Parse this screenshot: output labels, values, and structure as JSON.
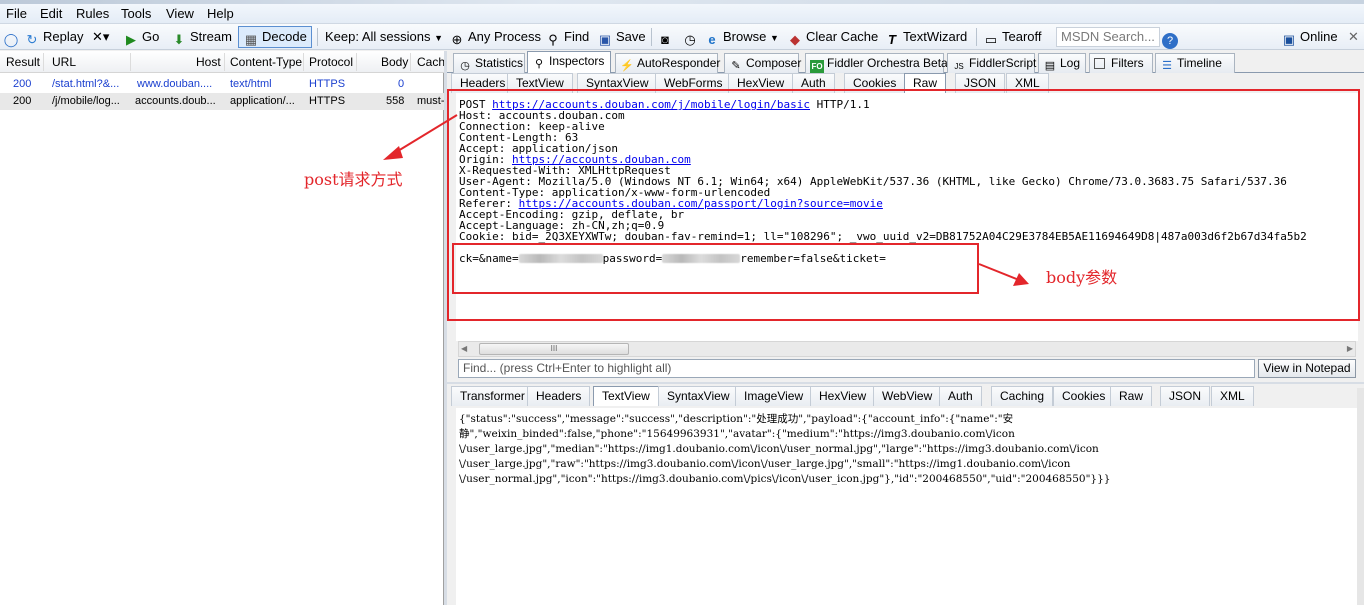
{
  "menu": [
    "File",
    "Edit",
    "Rules",
    "Tools",
    "View",
    "Help"
  ],
  "toolbar": {
    "replay": "Replay",
    "remove": "✕▾",
    "go": "Go",
    "stream": "Stream",
    "decode": "Decode",
    "keep": "Keep: All sessions",
    "any_process": "Any Process",
    "find": "Find",
    "save": "Save",
    "browse": "Browse",
    "clear_cache": "Clear Cache",
    "textwizard": "TextWizard",
    "tearoff": "Tearoff",
    "msdn_search": "MSDN Search...",
    "online": "Online"
  },
  "sessions": {
    "columns": [
      "Result",
      "URL",
      "Host",
      "Content-Type",
      "Protocol",
      "Body",
      "Cachi"
    ],
    "rows": [
      {
        "result": "200",
        "url": "/stat.html?&...",
        "host": "www.douban....",
        "ctype": "text/html",
        "protocol": "HTTPS",
        "body": "0",
        "caching": ""
      },
      {
        "result": "200",
        "url": "/j/mobile/log...",
        "host": "accounts.doub...",
        "ctype": "application/...",
        "protocol": "HTTPS",
        "body": "558",
        "caching": "must-"
      }
    ]
  },
  "main_tabs": [
    "Statistics",
    "Inspectors",
    "AutoResponder",
    "Composer",
    "Fiddler Orchestra Beta",
    "FiddlerScript",
    "Log",
    "Filters",
    "Timeline"
  ],
  "request_tabs": [
    "Headers",
    "TextView",
    "SyntaxView",
    "WebForms",
    "HexView",
    "Auth",
    "Cookies",
    "Raw",
    "JSON",
    "XML"
  ],
  "request": {
    "line1_method": "POST ",
    "line1_url": "https://accounts.douban.com/j/mobile/login/basic",
    "line1_proto": " HTTP/1.1",
    "host": "Host: accounts.douban.com",
    "connection": "Connection: keep-alive",
    "content_length": "Content-Length: 63",
    "accept": "Accept: application/json",
    "origin_label": "Origin: ",
    "origin_url": "https://accounts.douban.com",
    "xrw": "X-Requested-With: XMLHttpRequest",
    "ua": "User-Agent: Mozilla/5.0 (Windows NT 6.1; Win64; x64) AppleWebKit/537.36 (KHTML, like Gecko) Chrome/73.0.3683.75 Safari/537.36",
    "ctype": "Content-Type: application/x-www-form-urlencoded",
    "referer_label": "Referer: ",
    "referer_url": "https://accounts.douban.com/passport/login?source=movie",
    "accept_encoding": "Accept-Encoding: gzip, deflate, br",
    "accept_language": "Accept-Language: zh-CN,zh;q=0.9",
    "cookie": "Cookie: bid=_2Q3XEYXWTw; douban-fav-remind=1; ll=\"108296\"; _vwo_uuid_v2=DB81752A04C29E3784EB5AE11694649D8|487a003d6f2b67d34fa5b2",
    "body_a": "ck=&name=",
    "body_b": "password=",
    "body_c": "remember=false&ticket="
  },
  "annotations": {
    "post": "post请求方式",
    "body": "body参数"
  },
  "find_placeholder": "Find... (press Ctrl+Enter to highlight all)",
  "view_in_notepad": "View in Notepad",
  "scroll_label": "III",
  "response_tabs": [
    "Transformer",
    "Headers",
    "TextView",
    "SyntaxView",
    "ImageView",
    "HexView",
    "WebView",
    "Auth",
    "Caching",
    "Cookies",
    "Raw",
    "JSON",
    "XML"
  ],
  "response_lines": [
    "{\"status\":\"success\",\"message\":\"success\",\"description\":\"处理成功\",\"payload\":{\"account_info\":{\"name\":\"安",
    "静\",\"weixin_binded\":false,\"phone\":\"15649963931\",\"avatar\":{\"medium\":\"https://img3.doubanio.com\\/icon",
    "\\/user_large.jpg\",\"median\":\"https://img1.doubanio.com\\/icon\\/user_normal.jpg\",\"large\":\"https://img3.doubanio.com\\/icon",
    "\\/user_large.jpg\",\"raw\":\"https://img3.doubanio.com\\/icon\\/user_large.jpg\",\"small\":\"https://img1.doubanio.com\\/icon",
    "\\/user_normal.jpg\",\"icon\":\"https://img3.doubanio.com\\/pics\\/icon\\/user_icon.jpg\"},\"id\":\"200468550\",\"uid\":\"200468550\"}}}"
  ]
}
